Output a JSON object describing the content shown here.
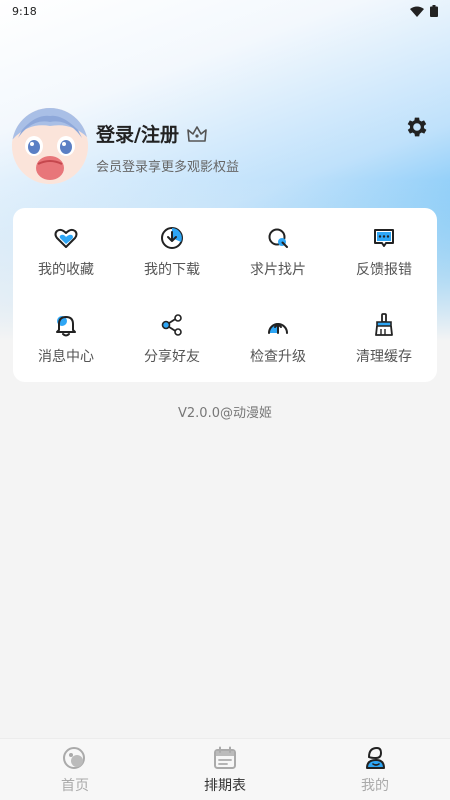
{
  "status": {
    "time": "9:18"
  },
  "profile": {
    "title": "登录/注册",
    "subtitle": "会员登录享更多观影权益"
  },
  "menu": [
    {
      "label": "我的收藏",
      "icon": "heart-icon"
    },
    {
      "label": "我的下载",
      "icon": "download-icon"
    },
    {
      "label": "求片找片",
      "icon": "search-film-icon"
    },
    {
      "label": "反馈报错",
      "icon": "feedback-icon"
    },
    {
      "label": "消息中心",
      "icon": "bell-icon"
    },
    {
      "label": "分享好友",
      "icon": "share-icon"
    },
    {
      "label": "检查升级",
      "icon": "upgrade-icon"
    },
    {
      "label": "清理缓存",
      "icon": "broom-icon"
    }
  ],
  "version": "V2.0.0@动漫姬",
  "nav": [
    {
      "label": "首页",
      "icon": "home-icon",
      "active": false
    },
    {
      "label": "排期表",
      "icon": "calendar-icon",
      "active": true
    },
    {
      "label": "我的",
      "icon": "profile-icon",
      "active": false
    }
  ],
  "colors": {
    "accent": "#2ea6f5",
    "text": "#333333",
    "muted": "#999999"
  }
}
